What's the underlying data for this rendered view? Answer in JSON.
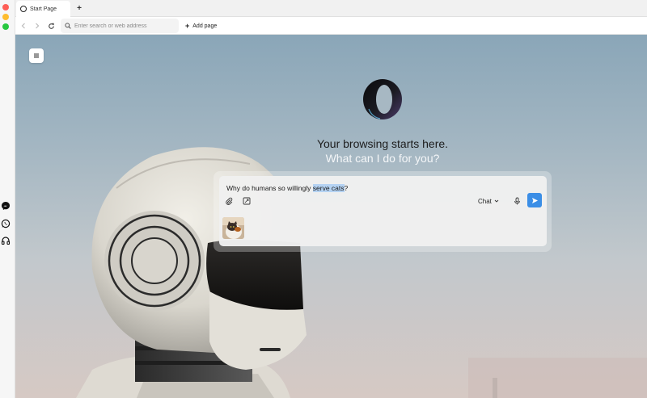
{
  "tabs": [
    {
      "label": "Start Page",
      "icon": "opera-logo-icon",
      "active": true
    }
  ],
  "toolbar": {
    "url_placeholder": "Enter search or web address",
    "url_value": "",
    "add_page_label": "Add page"
  },
  "sidebar": {
    "items": [
      {
        "name": "messenger",
        "icon": "messenger-icon"
      },
      {
        "name": "whatsapp",
        "icon": "whatsapp-icon"
      },
      {
        "name": "music-player",
        "icon": "headphones-icon"
      }
    ]
  },
  "main": {
    "headline": "Your browsing starts here.",
    "subline": "What can I do for you?"
  },
  "prompt": {
    "text_before": "Why do humans so willingly ",
    "text_selected": "serve cats",
    "text_after": "?",
    "mode_label": "Chat",
    "attachment_icon": "paperclip-icon",
    "screenshot_icon": "screenshot-crop-icon",
    "mic_icon": "microphone-icon",
    "send_icon": "send-arrow-icon",
    "attachment_thumb": "cat-image-thumbnail"
  },
  "colors": {
    "accent": "#3b8ee6",
    "selection": "#b5d3f3",
    "traffic_red": "#fe5f57",
    "traffic_yellow": "#febc2e",
    "traffic_green": "#28c840"
  }
}
